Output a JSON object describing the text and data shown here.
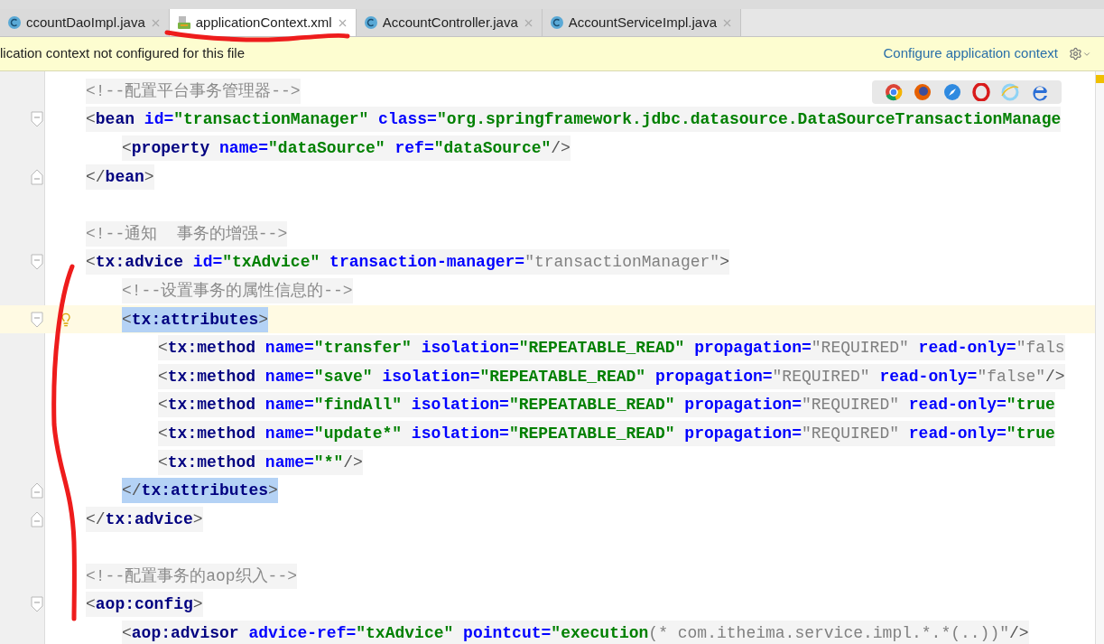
{
  "tabs": [
    {
      "label": "ccountDaoImpl.java",
      "kind": "class",
      "selected": false
    },
    {
      "label": "applicationContext.xml",
      "kind": "xml",
      "selected": true
    },
    {
      "label": "AccountController.java",
      "kind": "class",
      "selected": false
    },
    {
      "label": "AccountServiceImpl.java",
      "kind": "class",
      "selected": false
    }
  ],
  "banner": {
    "message": "lication context not configured for this file",
    "link": "Configure application context"
  },
  "lines": [
    {
      "kind": "code",
      "current": false,
      "matched": false,
      "tokens": [
        {
          "kind": "comment",
          "text": "<!--配置平台事务管理器-->"
        }
      ]
    },
    {
      "kind": "code",
      "current": false,
      "matched": false,
      "tokens": [
        {
          "kind": "punct",
          "text": "<"
        },
        {
          "kind": "tag",
          "text": "bean"
        },
        {
          "kind": "attr",
          "text": " id="
        },
        {
          "kind": "value",
          "text": "\"transactionManager\""
        },
        {
          "kind": "attr",
          "text": " class="
        },
        {
          "kind": "value",
          "text": "\"org.springframework.jdbc.datasource.DataSourceTransactionManage"
        }
      ],
      "children": [
        {
          "kind": "code",
          "current": false,
          "matched": false,
          "tokens": [
            {
              "kind": "punct",
              "text": "<"
            },
            {
              "kind": "tag",
              "text": "property"
            },
            {
              "kind": "attr",
              "text": " name="
            },
            {
              "kind": "value",
              "text": "\"dataSource\""
            },
            {
              "kind": "attr",
              "text": " ref="
            },
            {
              "kind": "value",
              "text": "\"dataSource\""
            },
            {
              "kind": "punct",
              "text": "/>"
            }
          ]
        }
      ],
      "end": {
        "kind": "code",
        "current": false,
        "matched": false,
        "tokens": [
          {
            "kind": "punct",
            "text": "</"
          },
          {
            "kind": "tag",
            "text": "bean"
          },
          {
            "kind": "punct",
            "text": ">"
          }
        ]
      }
    },
    {
      "kind": "blank"
    },
    {
      "kind": "code",
      "current": false,
      "matched": false,
      "tokens": [
        {
          "kind": "comment",
          "text": "<!--通知  事务的增强-->"
        }
      ]
    },
    {
      "kind": "code",
      "current": false,
      "matched": false,
      "tokens": [
        {
          "kind": "punct",
          "text": "<"
        },
        {
          "kind": "tag",
          "text": "tx:advice"
        },
        {
          "kind": "attr",
          "text": " id="
        },
        {
          "kind": "value",
          "text": "\"txAdvice\""
        },
        {
          "kind": "attr",
          "text": " transaction-manager="
        },
        {
          "kind": "plain",
          "text": "\"transactionManager\""
        },
        {
          "kind": "punct",
          "text": ">"
        }
      ],
      "children": [
        {
          "kind": "code",
          "current": false,
          "matched": false,
          "tokens": [
            {
              "kind": "comment",
              "text": "<!--设置事务的属性信息的-->"
            }
          ]
        },
        {
          "kind": "code",
          "current": true,
          "matched": true,
          "tokens": [
            {
              "kind": "punct",
              "text": "<"
            },
            {
              "kind": "tag",
              "text": "tx:attributes"
            },
            {
              "kind": "punct",
              "text": ">"
            }
          ],
          "children": [
            {
              "kind": "code",
              "current": false,
              "matched": false,
              "tokens": [
                {
                  "kind": "punct",
                  "text": "<"
                },
                {
                  "kind": "tag",
                  "text": "tx:method"
                },
                {
                  "kind": "attr",
                  "text": " name="
                },
                {
                  "kind": "value",
                  "text": "\"transfer\""
                },
                {
                  "kind": "attr",
                  "text": " isolation="
                },
                {
                  "kind": "value",
                  "text": "\"REPEATABLE_READ\""
                },
                {
                  "kind": "attr",
                  "text": " propagation="
                },
                {
                  "kind": "plain",
                  "text": "\"REQUIRED\""
                },
                {
                  "kind": "attr",
                  "text": " read-only="
                },
                {
                  "kind": "plain",
                  "text": "\"fals"
                }
              ]
            },
            {
              "kind": "code",
              "current": false,
              "matched": false,
              "tokens": [
                {
                  "kind": "punct",
                  "text": "<"
                },
                {
                  "kind": "tag",
                  "text": "tx:method"
                },
                {
                  "kind": "attr",
                  "text": " name="
                },
                {
                  "kind": "value",
                  "text": "\"save\""
                },
                {
                  "kind": "attr",
                  "text": " isolation="
                },
                {
                  "kind": "value",
                  "text": "\"REPEATABLE_READ\""
                },
                {
                  "kind": "attr",
                  "text": " propagation="
                },
                {
                  "kind": "plain",
                  "text": "\"REQUIRED\""
                },
                {
                  "kind": "attr",
                  "text": " read-only="
                },
                {
                  "kind": "plain",
                  "text": "\"false\""
                },
                {
                  "kind": "punct",
                  "text": "/>"
                }
              ]
            },
            {
              "kind": "code",
              "current": false,
              "matched": false,
              "tokens": [
                {
                  "kind": "punct",
                  "text": "<"
                },
                {
                  "kind": "tag",
                  "text": "tx:method"
                },
                {
                  "kind": "attr",
                  "text": " name="
                },
                {
                  "kind": "value",
                  "text": "\"findAll\""
                },
                {
                  "kind": "attr",
                  "text": " isolation="
                },
                {
                  "kind": "value",
                  "text": "\"REPEATABLE_READ\""
                },
                {
                  "kind": "attr",
                  "text": " propagation="
                },
                {
                  "kind": "plain",
                  "text": "\"REQUIRED\""
                },
                {
                  "kind": "attr",
                  "text": " read-only="
                },
                {
                  "kind": "value",
                  "text": "\"true"
                }
              ]
            },
            {
              "kind": "code",
              "current": false,
              "matched": false,
              "tokens": [
                {
                  "kind": "punct",
                  "text": "<"
                },
                {
                  "kind": "tag",
                  "text": "tx:method"
                },
                {
                  "kind": "attr",
                  "text": " name="
                },
                {
                  "kind": "value",
                  "text": "\"update*\""
                },
                {
                  "kind": "attr",
                  "text": " isolation="
                },
                {
                  "kind": "value",
                  "text": "\"REPEATABLE_READ\""
                },
                {
                  "kind": "attr",
                  "text": " propagation="
                },
                {
                  "kind": "plain",
                  "text": "\"REQUIRED\""
                },
                {
                  "kind": "attr",
                  "text": " read-only="
                },
                {
                  "kind": "value",
                  "text": "\"true"
                }
              ]
            },
            {
              "kind": "code",
              "current": false,
              "matched": false,
              "tokens": [
                {
                  "kind": "punct",
                  "text": "<"
                },
                {
                  "kind": "tag",
                  "text": "tx:method"
                },
                {
                  "kind": "attr",
                  "text": " name="
                },
                {
                  "kind": "value",
                  "text": "\"*\""
                },
                {
                  "kind": "punct",
                  "text": "/>"
                }
              ]
            }
          ],
          "end": {
            "kind": "code",
            "current": false,
            "matched": true,
            "tokens": [
              {
                "kind": "punct",
                "text": "</"
              },
              {
                "kind": "tag",
                "text": "tx:attributes"
              },
              {
                "kind": "punct",
                "text": ">"
              }
            ]
          }
        }
      ],
      "end": {
        "kind": "code",
        "current": false,
        "matched": false,
        "tokens": [
          {
            "kind": "punct",
            "text": "</"
          },
          {
            "kind": "tag",
            "text": "tx:advice"
          },
          {
            "kind": "punct",
            "text": ">"
          }
        ]
      }
    },
    {
      "kind": "blank"
    },
    {
      "kind": "code",
      "current": false,
      "matched": false,
      "tokens": [
        {
          "kind": "comment",
          "text": "<!--配置事务的aop织入-->"
        }
      ]
    },
    {
      "kind": "code",
      "current": false,
      "matched": false,
      "tokens": [
        {
          "kind": "punct",
          "text": "<"
        },
        {
          "kind": "tag",
          "text": "aop:config"
        },
        {
          "kind": "punct",
          "text": ">"
        }
      ],
      "children": [
        {
          "kind": "code",
          "current": false,
          "matched": false,
          "tokens": [
            {
              "kind": "punct",
              "text": "<"
            },
            {
              "kind": "tag",
              "text": "aop:advisor"
            },
            {
              "kind": "attr",
              "text": " advice-ref="
            },
            {
              "kind": "value",
              "text": "\"txAdvice\""
            },
            {
              "kind": "attr",
              "text": " pointcut="
            },
            {
              "kind": "value",
              "text": "\"execution"
            },
            {
              "kind": "plain",
              "text": "(* com.itheima.service.impl.*.*(..))\""
            },
            {
              "kind": "punct",
              "text": "/>"
            }
          ]
        }
      ]
    }
  ]
}
